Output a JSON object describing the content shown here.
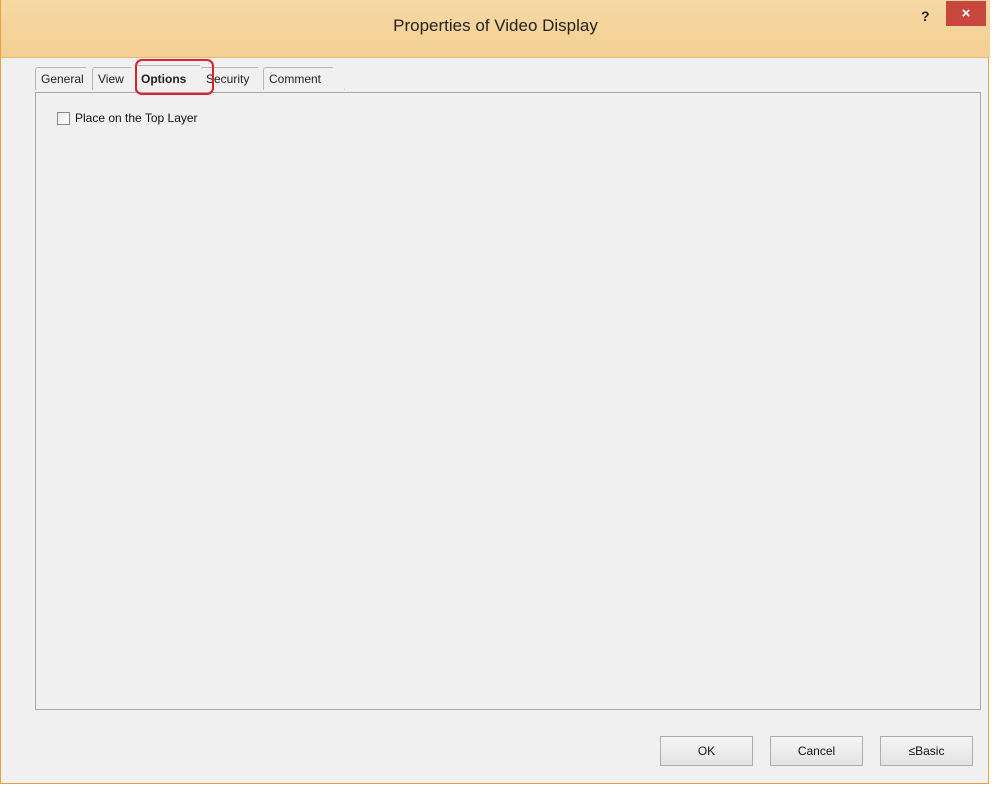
{
  "window": {
    "title": "Properties of Video Display",
    "help_label": "?",
    "close_label": "×"
  },
  "tabs": [
    {
      "label": "General"
    },
    {
      "label": "View"
    },
    {
      "label": "Options",
      "active": true
    },
    {
      "label": "Security"
    },
    {
      "label": "Comment"
    }
  ],
  "options": {
    "top_layer_label": "Place on the Top Layer",
    "top_layer_checked": false
  },
  "buttons": {
    "ok": "OK",
    "cancel": "Cancel",
    "basic": "≤Basic"
  },
  "colors": {
    "titlebar": "#f3cf92",
    "close": "#c7463e",
    "highlight": "#e0202a"
  }
}
